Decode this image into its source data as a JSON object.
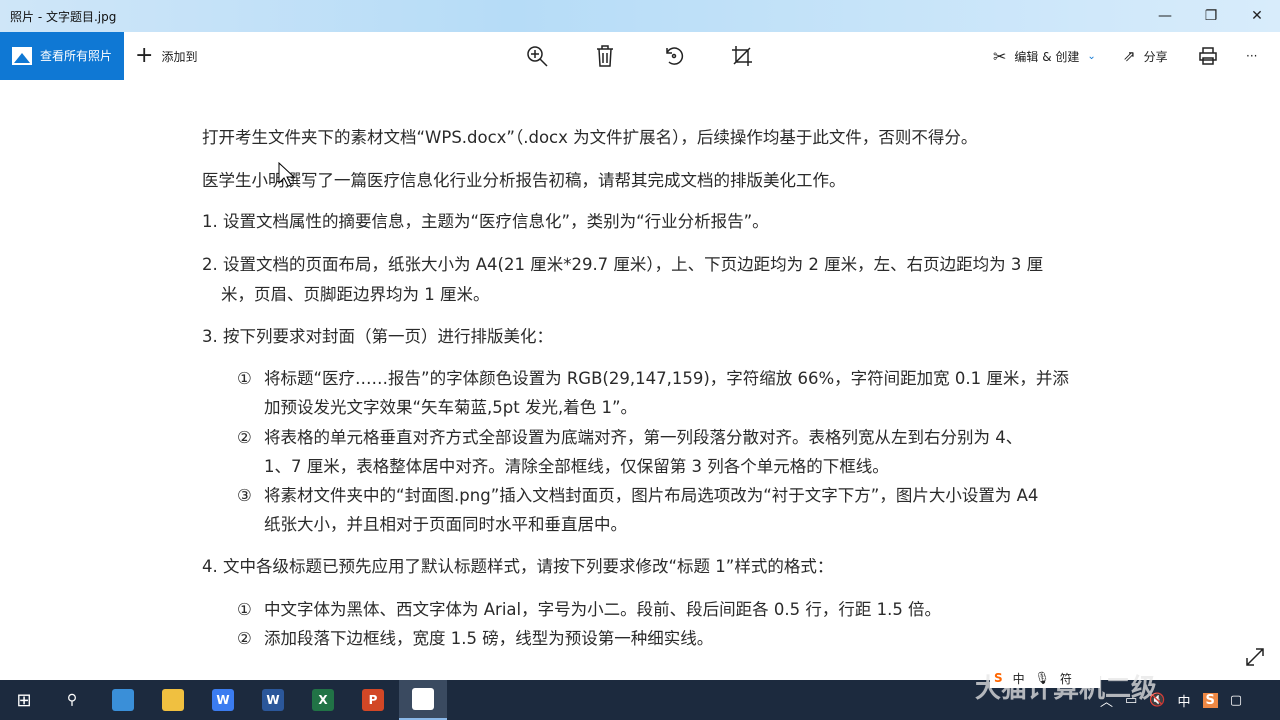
{
  "window": {
    "title": "照片 - 文字题目.jpg",
    "minimize": "—",
    "restore": "❐",
    "close": "✕"
  },
  "toolbar": {
    "view_all": "查看所有照片",
    "add_to": "添加到",
    "edit_create": "编辑 & 创建",
    "share": "分享",
    "more": "···"
  },
  "doc": {
    "intro1": "打开考生文件夹下的素材文档“WPS.docx”（.docx 为文件扩展名），后续操作均基于此文件，否则不得分。",
    "intro2": "医学生小明撰写了一篇医疗信息化行业分析报告初稿，请帮其完成文档的排版美化工作。",
    "item1": "1. 设置文档属性的摘要信息，主题为“医疗信息化”，类别为“行业分析报告”。",
    "item2a": "2. 设置文档的页面布局，纸张大小为 A4(21 厘米*29.7 厘米），上、下页边距均为 2 厘米，左、右页边距均为 3 厘",
    "item2b": "米，页眉、页脚距边界均为 1 厘米。",
    "item3": "3. 按下列要求对封面（第一页）进行排版美化：",
    "item3_1a": "将标题“医疗……报告”的字体颜色设置为 RGB(29,147,159)，字符缩放 66%，字符间距加宽 0.1 厘米，并添",
    "item3_1b": "加预设发光文字效果“矢车菊蓝,5pt 发光,着色 1”。",
    "item3_2a": "将表格的单元格垂直对齐方式全部设置为底端对齐，第一列段落分散对齐。表格列宽从左到右分别为 4、",
    "item3_2b": "1、7 厘米，表格整体居中对齐。清除全部框线，仅保留第 3 列各个单元格的下框线。",
    "item3_3a": "将素材文件夹中的“封面图.png”插入文档封面页，图片布局选项改为“衬于文字下方”，图片大小设置为 A4",
    "item3_3b": "纸张大小，并且相对于页面同时水平和垂直居中。",
    "item4": "4. 文中各级标题已预先应用了默认标题样式，请按下列要求修改“标题 1”样式的格式：",
    "item4_1": "中文字体为黑体、西文字体为 Arial，字号为小二。段前、段后间距各 0.5 行，行距 1.5 倍。",
    "item4_2": "添加段落下边框线，宽度 1.5 磅，线型为预设第一种细实线。",
    "n1": "①",
    "n2": "②",
    "n3": "③"
  },
  "watermark": "大猫计算机二级",
  "ime": {
    "lang": "中",
    "punct": "符"
  },
  "tray": {
    "lang": "中"
  },
  "accent": "#0f78d4"
}
